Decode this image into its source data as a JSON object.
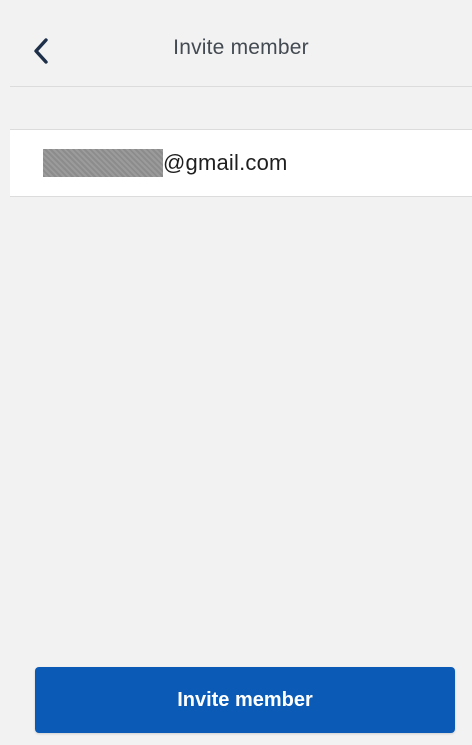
{
  "header": {
    "title": "Invite member",
    "back_icon": "chevron-left-icon"
  },
  "invite_form": {
    "email_value": "@gmail.com"
  },
  "footer": {
    "invite_button_label": "Invite member"
  },
  "colors": {
    "background": "#f2f2f2",
    "row_background": "#ffffff",
    "primary_button": "#0b5bb6",
    "title_text": "#444a52",
    "back_icon": "#1e2f4a"
  }
}
